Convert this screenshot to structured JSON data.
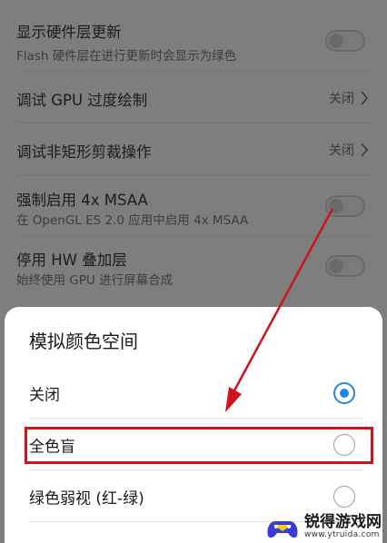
{
  "settings": {
    "hardware_layers": {
      "title": "显示硬件层更新",
      "subtitle": "Flash 硬件层在进行更新时会显示为绿色"
    },
    "gpu_overdraw": {
      "title": "调试 GPU 过度绘制",
      "value": "关闭"
    },
    "non_rect_clip": {
      "title": "调试非矩形剪裁操作",
      "value": "关闭"
    },
    "force_msaa": {
      "title": "强制启用 4x MSAA",
      "subtitle": "在 OpenGL ES 2.0 应用中启用 4x MSAA"
    },
    "disable_hw_overlay": {
      "title": "停用 HW 叠加层",
      "subtitle": "始终使用 GPU 进行屏幕合成"
    }
  },
  "dialog": {
    "title": "模拟颜色空间",
    "options": [
      {
        "label": "关闭",
        "selected": true
      },
      {
        "label": "全色盲",
        "selected": false
      },
      {
        "label": "绿色弱视 (红-绿)",
        "selected": false
      }
    ]
  },
  "watermark": {
    "name": "锐得游戏网",
    "url": "www.ytruida.com"
  },
  "colors": {
    "accent_blue": "#1e88e5",
    "annotation_red": "#d0121b"
  }
}
